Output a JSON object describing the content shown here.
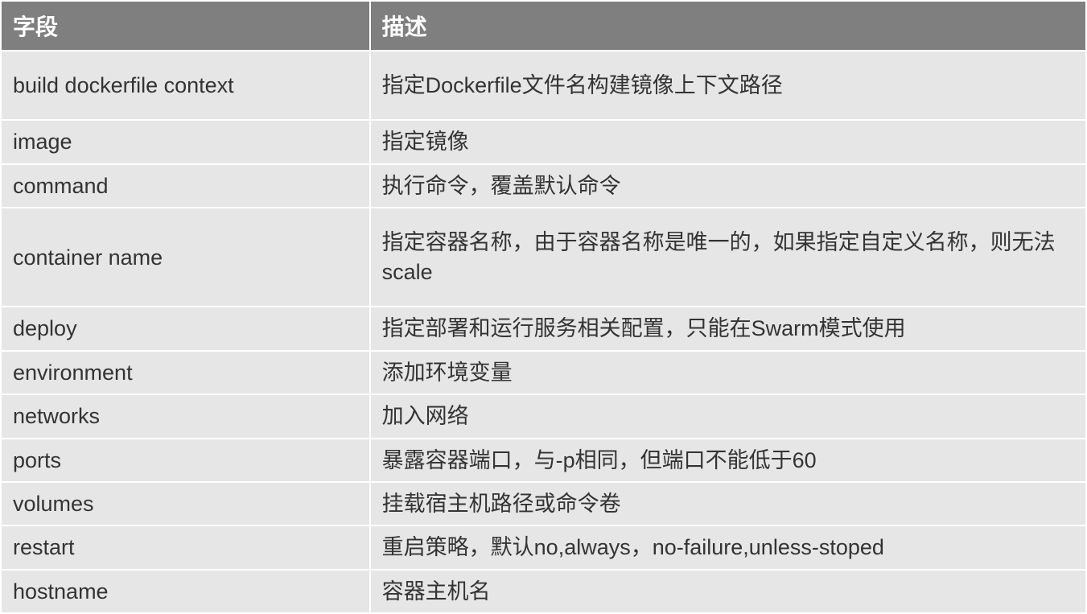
{
  "table": {
    "headers": {
      "field": "字段",
      "description": "描述"
    },
    "rows": [
      {
        "field": "build  dockerfile  context",
        "description": "指定Dockerfile文件名构建镜像上下文路径",
        "tall": true
      },
      {
        "field": "image",
        "description": "指定镜像"
      },
      {
        "field": "command",
        "description": "执行命令，覆盖默认命令"
      },
      {
        "field": "container name",
        "description": "指定容器名称，由于容器名称是唯一的，如果指定自定义名称，则无法scale",
        "tall": true
      },
      {
        "field": "deploy",
        "description": "指定部署和运行服务相关配置，只能在Swarm模式使用"
      },
      {
        "field": "environment",
        "description": "添加环境变量"
      },
      {
        "field": "networks",
        "description": "加入网络"
      },
      {
        "field": "ports",
        "description": "暴露容器端口，与-p相同，但端口不能低于60"
      },
      {
        "field": "volumes",
        "description": "挂载宿主机路径或命令卷"
      },
      {
        "field": "restart",
        "description": "重启策略，默认no,always，no-failure,unless-stoped"
      },
      {
        "field": "hostname",
        "description": "容器主机名"
      }
    ]
  }
}
